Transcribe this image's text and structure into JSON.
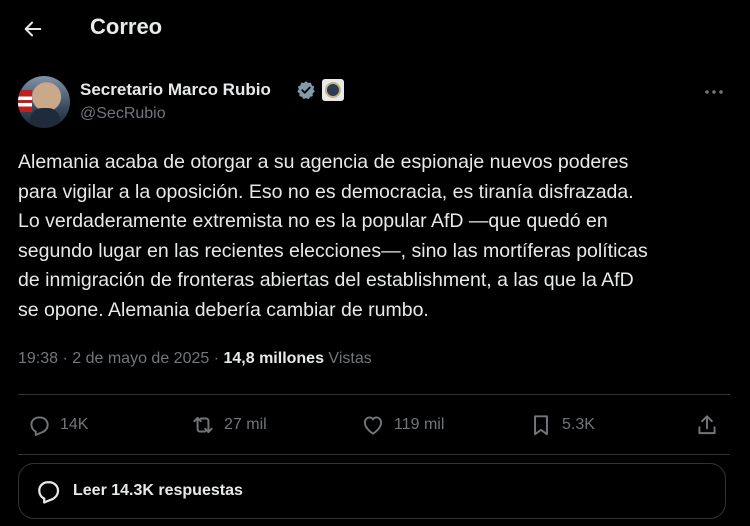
{
  "header": {
    "title": "Correo",
    "back_icon": "arrow-left-icon"
  },
  "author": {
    "name": "Secretario Marco Rubio",
    "handle": "@SecRubio",
    "verified_color": "#829aab"
  },
  "tweet": {
    "lines": [
      "Alemania acaba de otorgar a su agencia de espionaje nuevos poderes",
      "para vigilar a la oposición. Eso no es democracia, es tiranía disfrazada.",
      "Lo verdaderamente extremista no es la popular AfD —que quedó en",
      "segundo lugar en las recientes elecciones—, sino las mortíferas políticas",
      "de inmigración de fronteras abiertas del establishment, a las que la AfD",
      "se opone. Alemania debería cambiar de rumbo."
    ],
    "time": "19:38",
    "separator": " · ",
    "date": "2 de mayo de 2025",
    "views_count": "14,8 millones",
    "views_label": " Vistas"
  },
  "actions": {
    "replies": "14K",
    "reposts": "27 mil",
    "likes": "119 mil",
    "bookmarks": "5.3K"
  },
  "read_replies": {
    "label": "Leer 14.3K respuestas"
  },
  "colors": {
    "background": "#000000",
    "text": "#e7e9ea",
    "muted": "#71767b",
    "border": "#2f3336"
  }
}
